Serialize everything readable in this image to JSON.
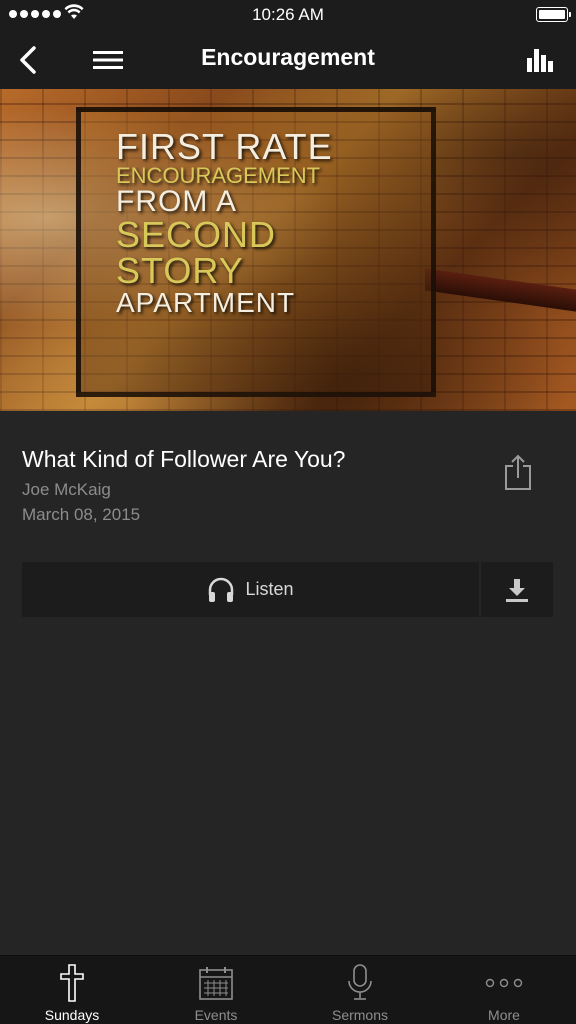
{
  "status_bar": {
    "time": "10:26 AM"
  },
  "nav": {
    "title": "Encouragement",
    "icons": [
      "back-icon",
      "menu-icon",
      "bar-chart-icon"
    ]
  },
  "artwork": {
    "lines": [
      "FIRST RATE",
      "ENCOURAGEMENT",
      "FROM A",
      "SECOND",
      "STORY",
      "APARTMENT"
    ]
  },
  "sermon": {
    "title": "What Kind of Follower Are You?",
    "speaker": "Joe McKaig",
    "date": "March 08, 2015"
  },
  "actions": {
    "listen_label": "Listen"
  },
  "tab_bar": {
    "tabs": [
      {
        "label": "Sundays",
        "icon": "cross-icon",
        "active": true
      },
      {
        "label": "Events",
        "icon": "calendar-icon",
        "active": false
      },
      {
        "label": "Sermons",
        "icon": "microphone-icon",
        "active": false
      },
      {
        "label": "More",
        "icon": "more-icon",
        "active": false
      }
    ]
  },
  "colors": {
    "background": "#252525",
    "bar": "#1c1c1c",
    "tab_bar": "#161616",
    "secondary_text": "#8c8c8c"
  }
}
